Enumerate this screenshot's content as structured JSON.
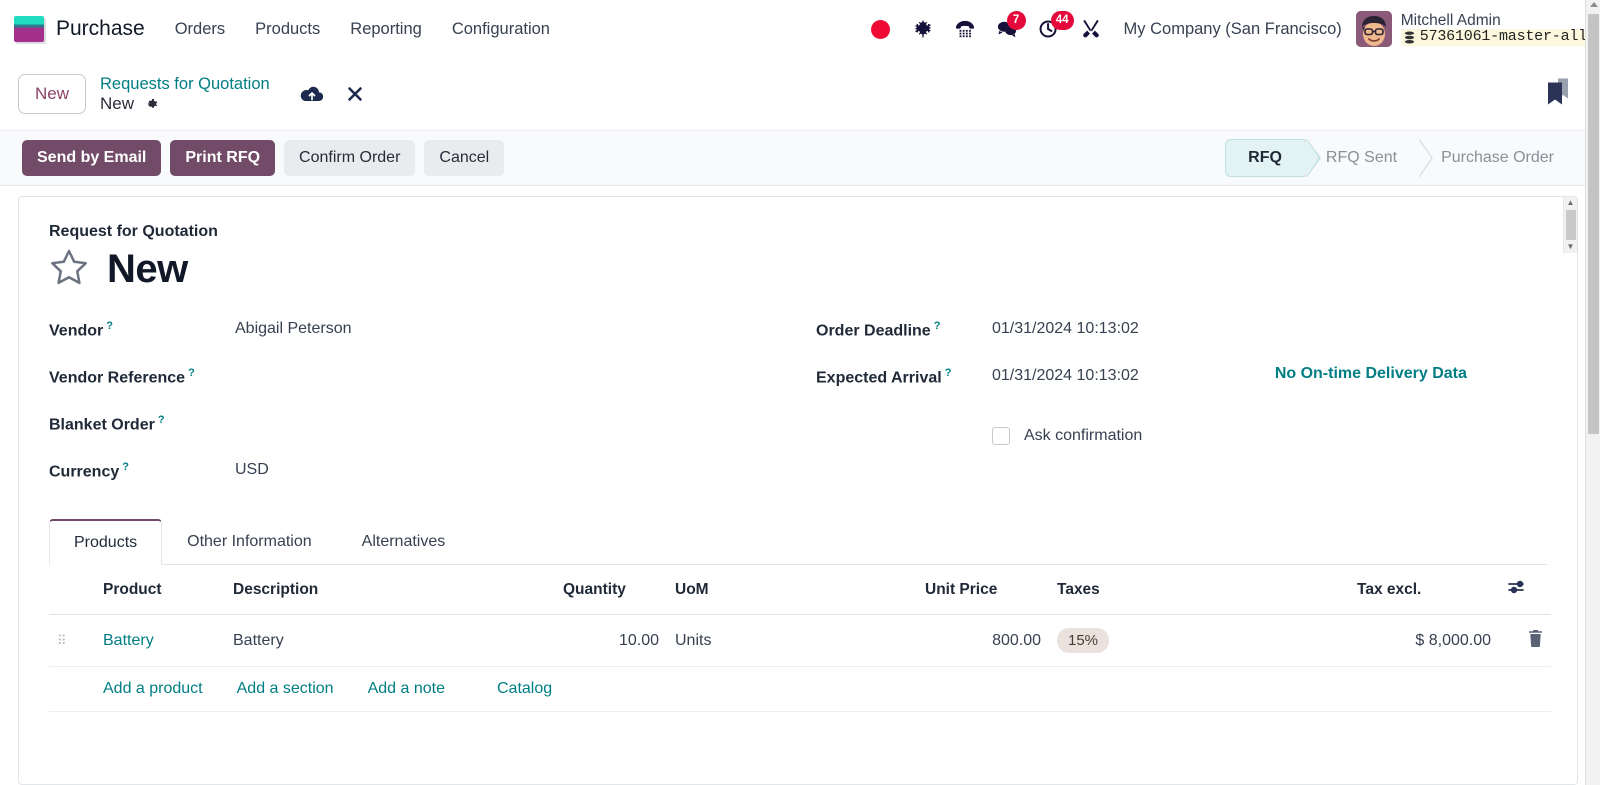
{
  "navbar": {
    "brand": "Purchase",
    "menu": [
      {
        "label": "Orders"
      },
      {
        "label": "Products"
      },
      {
        "label": "Reporting"
      },
      {
        "label": "Configuration"
      }
    ],
    "icons": [
      {
        "name": "record-dot-icon",
        "badge": ""
      },
      {
        "name": "bug-icon",
        "badge": ""
      },
      {
        "name": "phone-icon",
        "badge": ""
      },
      {
        "name": "messages-icon",
        "badge": "7"
      },
      {
        "name": "activities-clock-icon",
        "badge": "44"
      },
      {
        "name": "tools-icon",
        "badge": ""
      }
    ],
    "company": "My Company (San Francisco)",
    "user_name": "Mitchell Admin",
    "database": "57361061-master-all"
  },
  "breadcrumb": {
    "new_chip": "New",
    "parent": "Requests for Quotation",
    "current": "New",
    "gear_icon": "gear-icon",
    "save_icon": "cloud-save-icon",
    "discard_icon": "discard-x-icon",
    "bookmark_icon": "bookmark-icon"
  },
  "control_panel": {
    "buttons": [
      {
        "label": "Send by Email",
        "style": "primary"
      },
      {
        "label": "Print RFQ",
        "style": "primary"
      },
      {
        "label": "Confirm Order",
        "style": "secondary"
      },
      {
        "label": "Cancel",
        "style": "secondary"
      }
    ],
    "status_steps": [
      {
        "label": "RFQ",
        "active": true
      },
      {
        "label": "RFQ Sent",
        "active": false
      },
      {
        "label": "Purchase Order",
        "active": false
      }
    ]
  },
  "form": {
    "subtitle": "Request for Quotation",
    "title": "New",
    "star_icon": "favorite-star-icon",
    "left_fields": [
      {
        "label": "Vendor",
        "value": "Abigail Peterson",
        "help": "?"
      },
      {
        "label": "Vendor Reference",
        "value": "",
        "help": "?"
      },
      {
        "label": "Blanket Order",
        "value": "",
        "help": "?"
      },
      {
        "label": "Currency",
        "value": "USD",
        "help": "?"
      }
    ],
    "right_fields": [
      {
        "label": "Order Deadline",
        "value": "01/31/2024 10:13:02",
        "help": "?"
      },
      {
        "label": "Expected Arrival",
        "value": "01/31/2024 10:13:02",
        "help": "?"
      }
    ],
    "delivery_note": "No On-time Delivery Data",
    "ask_confirmation_label": "Ask confirmation",
    "ask_confirmation_checked": false
  },
  "notebook": {
    "tabs": [
      {
        "label": "Products",
        "active": true
      },
      {
        "label": "Other Information",
        "active": false
      },
      {
        "label": "Alternatives",
        "active": false
      }
    ]
  },
  "lines_table": {
    "headers": {
      "product": "Product",
      "description": "Description",
      "quantity": "Quantity",
      "uom": "UoM",
      "unit_price": "Unit Price",
      "taxes": "Taxes",
      "subtotal": "Tax excl.",
      "options_icon": "column-options-icon"
    },
    "rows": [
      {
        "handle_icon": "drag-handle-icon",
        "product": "Battery",
        "description": "Battery",
        "quantity": "10.00",
        "uom": "Units",
        "unit_price": "800.00",
        "tax": "15%",
        "subtotal": "$ 8,000.00",
        "delete_icon": "trash-icon"
      }
    ],
    "add_links": [
      {
        "label": "Add a product"
      },
      {
        "label": "Add a section"
      },
      {
        "label": "Add a note"
      },
      {
        "label": "Catalog"
      }
    ]
  },
  "colors": {
    "primary": "#714b67",
    "link": "#017e84",
    "badge": "#e5093b",
    "status_active_bg": "#e3f3f4"
  }
}
